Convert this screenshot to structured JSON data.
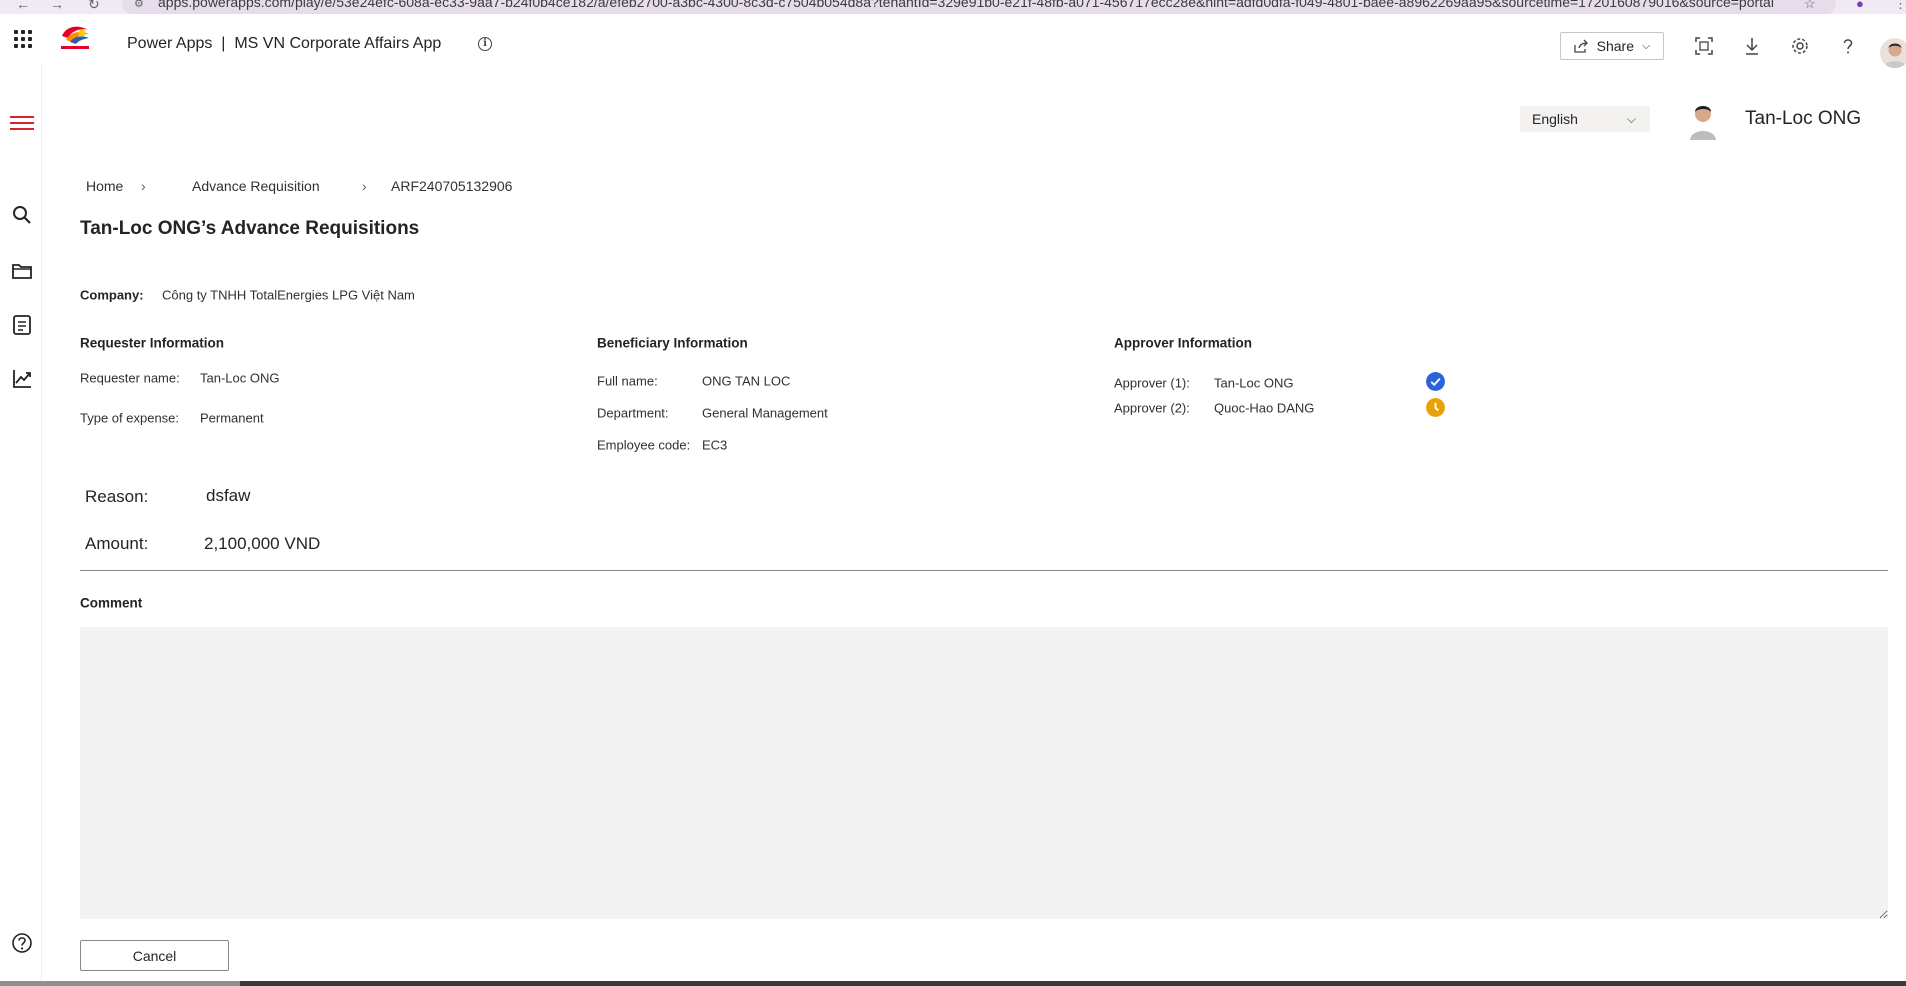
{
  "browser": {
    "url": "apps.powerapps.com/play/e/53e24efc-608a-ec33-9aa7-b24f0b4ce182/a/efeb2700-a3bc-4300-8c3d-c7504b054d8a?tenantId=329e91b0-e21f-48fb-a071-456717ecc28e&hint=adfd0dfa-f049-4801-baee-a8962269aa95&sourcetime=1720160879016&source=portal"
  },
  "header": {
    "title": "Power Apps  |  MS VN Corporate Affairs App",
    "share_label": "Share"
  },
  "language": {
    "selected": "English"
  },
  "user": {
    "name": "Tan-Loc ONG"
  },
  "breadcrumb": {
    "items": [
      "Home",
      "Advance Requisition",
      "ARF240705132906"
    ]
  },
  "page": {
    "title": "Tan-Loc ONG’s Advance Requisitions",
    "company_label": "Company:",
    "company_value": "Công ty TNHH TotalEnergies LPG Việt Nam"
  },
  "requester": {
    "title": "Requester Information",
    "name_label": "Requester name:",
    "name_value": "Tan-Loc ONG",
    "expense_label": "Type of expense:",
    "expense_value": "Permanent"
  },
  "beneficiary": {
    "title": "Beneficiary Information",
    "fullname_label": "Full name:",
    "fullname_value": "ONG TAN LOC",
    "department_label": "Department:",
    "department_value": "General Management",
    "code_label": "Employee code:",
    "code_value": "EC3"
  },
  "approver": {
    "title": "Approver Information",
    "items": [
      {
        "label": "Approver (1):",
        "name": "Tan-Loc ONG",
        "status": "approved",
        "color": "#2b63d9"
      },
      {
        "label": "Approver (2):",
        "name": "Quoc-Hao DANG",
        "status": "pending",
        "color": "#e8a208"
      }
    ]
  },
  "request": {
    "reason_label": "Reason:",
    "reason_value": "dsfaw",
    "amount_label": "Amount:",
    "amount_value": "2,100,000 VND"
  },
  "comment": {
    "title": "Comment",
    "value": ""
  },
  "actions": {
    "cancel_label": "Cancel"
  },
  "colors": {
    "brand_red": "#d6242c",
    "approved": "#2b63d9",
    "pending": "#e8a208"
  }
}
